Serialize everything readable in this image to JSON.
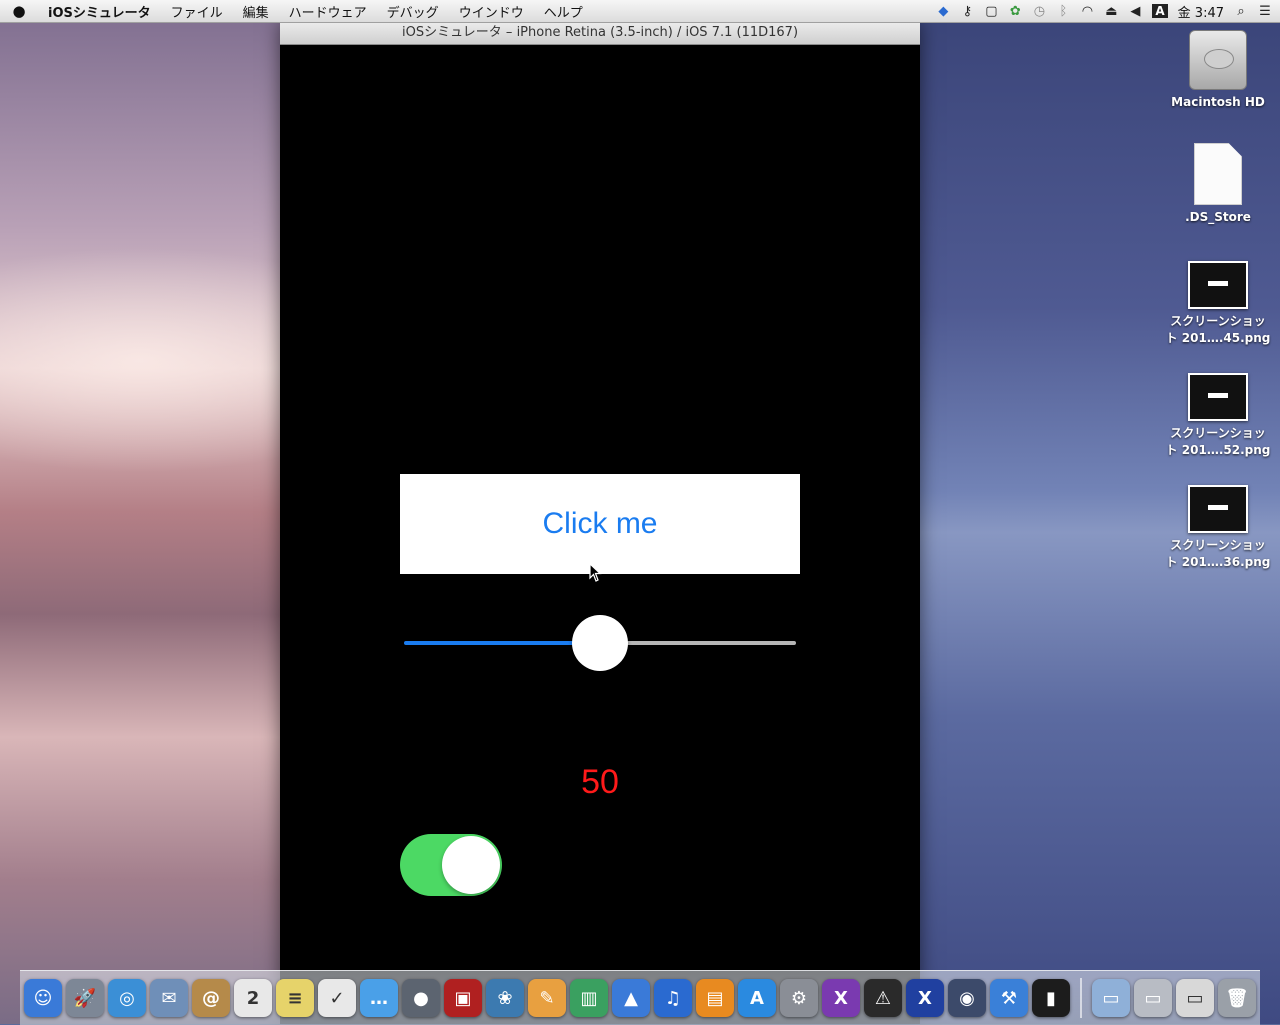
{
  "menubar": {
    "app_name": "iOSシミュレータ",
    "items": [
      "ファイル",
      "編集",
      "ハードウェア",
      "デバッグ",
      "ウインドウ",
      "ヘルプ"
    ],
    "clock": "金 3:47",
    "input_method": "A"
  },
  "simulator": {
    "title": "iOSシミュレータ – iPhone Retina (3.5-inch) / iOS 7.1 (11D167)",
    "button_label": "Click me",
    "slider_value": 0.5,
    "value_label": "50",
    "switch_on": true,
    "colors": {
      "button_text": "#1a7cf0",
      "label": "#ff1a1a",
      "switch_on": "#4cd964"
    }
  },
  "desktop": {
    "icons": [
      {
        "label": "Macintosh HD",
        "kind": "drive"
      },
      {
        "label": ".DS_Store",
        "kind": "document"
      },
      {
        "label_line1": "スクリーンショッ",
        "label_line2": "ト 201….45.png",
        "kind": "screenshot"
      },
      {
        "label_line1": "スクリーンショッ",
        "label_line2": "ト 201….52.png",
        "kind": "screenshot"
      },
      {
        "label_line1": "スクリーンショッ",
        "label_line2": "ト 201….36.png",
        "kind": "screenshot"
      }
    ]
  },
  "dock": {
    "apps": [
      {
        "name": "finder-icon",
        "glyph": "☺",
        "color": "#3a7ad8"
      },
      {
        "name": "launchpad-icon",
        "glyph": "🚀",
        "color": "#7d8796"
      },
      {
        "name": "safari-icon",
        "glyph": "◎",
        "color": "#3b8fd6"
      },
      {
        "name": "mail-icon",
        "glyph": "✉",
        "color": "#6f8fb8"
      },
      {
        "name": "contacts-icon",
        "glyph": "@",
        "color": "#b58a4a"
      },
      {
        "name": "calendar-icon",
        "glyph": "2",
        "color": "#e8e8e8"
      },
      {
        "name": "notes-icon",
        "glyph": "≡",
        "color": "#e6d36a"
      },
      {
        "name": "reminders-icon",
        "glyph": "✓",
        "color": "#e8e8e8"
      },
      {
        "name": "messages-icon",
        "glyph": "…",
        "color": "#4aa0e8"
      },
      {
        "name": "facetime-icon",
        "glyph": "●",
        "color": "#5c6470"
      },
      {
        "name": "photo-booth-icon",
        "glyph": "▣",
        "color": "#b02020"
      },
      {
        "name": "iphoto-icon",
        "glyph": "❀",
        "color": "#3c7ab0"
      },
      {
        "name": "pages-icon",
        "glyph": "✎",
        "color": "#e8a040"
      },
      {
        "name": "numbers-icon",
        "glyph": "▥",
        "color": "#3aa060"
      },
      {
        "name": "keynote-icon",
        "glyph": "▲",
        "color": "#3a7ad8"
      },
      {
        "name": "itunes-icon",
        "glyph": "♫",
        "color": "#2a6ad0"
      },
      {
        "name": "ibooks-icon",
        "glyph": "▤",
        "color": "#e88a20"
      },
      {
        "name": "app-store-icon",
        "glyph": "A",
        "color": "#2a8ae0"
      },
      {
        "name": "system-preferences-icon",
        "glyph": "⚙",
        "color": "#8a8e96"
      },
      {
        "name": "xamarin-icon",
        "glyph": "X",
        "color": "#7a3ab0"
      },
      {
        "name": "console-icon",
        "glyph": "⚠",
        "color": "#2a2a2a"
      },
      {
        "name": "x11-icon",
        "glyph": "X",
        "color": "#2040a0"
      },
      {
        "name": "instruments-icon",
        "glyph": "◉",
        "color": "#3c4a6a"
      },
      {
        "name": "xcode-icon",
        "glyph": "⚒",
        "color": "#3a80d8"
      },
      {
        "name": "ios-simulator-icon",
        "glyph": "▮",
        "color": "#1c1c1c"
      }
    ],
    "stacks": [
      {
        "name": "applications-folder-icon",
        "glyph": "▭",
        "color": "#8fb0d8"
      },
      {
        "name": "documents-stack-icon",
        "glyph": "▭",
        "color": "#b8bcc4"
      },
      {
        "name": "downloads-stack-icon",
        "glyph": "▭",
        "color": "#d8d8d8"
      },
      {
        "name": "trash-icon",
        "glyph": "🗑",
        "color": "#9aa0a8"
      }
    ]
  }
}
